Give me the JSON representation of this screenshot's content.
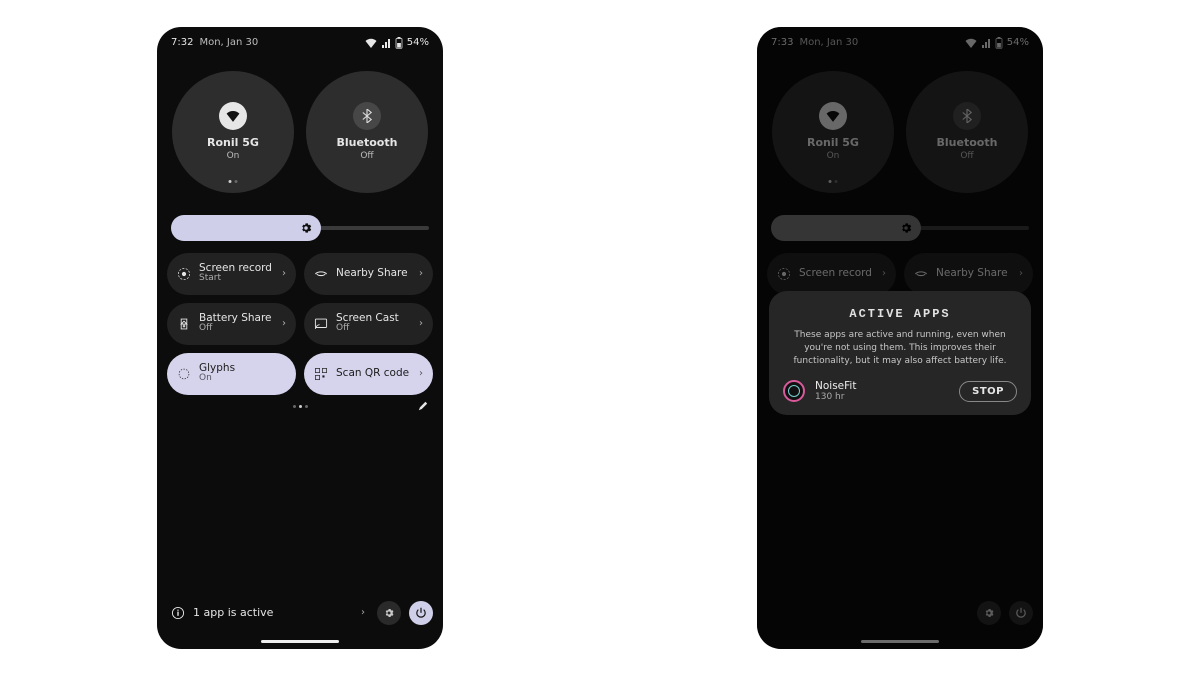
{
  "left": {
    "status": {
      "time": "7:32",
      "date": "Mon, Jan 30",
      "battery": "54%"
    },
    "big": [
      {
        "label": "Ronil 5G",
        "state": "On"
      },
      {
        "label": "Bluetooth",
        "state": "Off"
      }
    ],
    "tiles": {
      "screen_record": {
        "label": "Screen record",
        "state": "Start"
      },
      "nearby_share": {
        "label": "Nearby Share",
        "state": ""
      },
      "battery_share": {
        "label": "Battery Share",
        "state": "Off"
      },
      "screen_cast": {
        "label": "Screen Cast",
        "state": "Off"
      },
      "glyphs": {
        "label": "Glyphs",
        "state": "On"
      },
      "scan_qr": {
        "label": "Scan QR code",
        "state": ""
      }
    },
    "active_apps_bar": "1 app is active"
  },
  "right": {
    "status": {
      "time": "7:33",
      "date": "Mon, Jan 30",
      "battery": "54%"
    },
    "big": [
      {
        "label": "Ronil 5G",
        "state": "On"
      },
      {
        "label": "Bluetooth",
        "state": "Off"
      }
    ],
    "tiles": {
      "screen_record": {
        "label": "Screen record",
        "state": ""
      },
      "nearby_share": {
        "label": "Nearby Share",
        "state": ""
      }
    },
    "dialog": {
      "title": "ACTIVE APPS",
      "body": "These apps are active and running, even when you're not using them. This improves their functionality, but it may also affect battery life.",
      "app_name": "NoiseFit",
      "app_sub": "130 hr",
      "stop": "STOP"
    }
  }
}
